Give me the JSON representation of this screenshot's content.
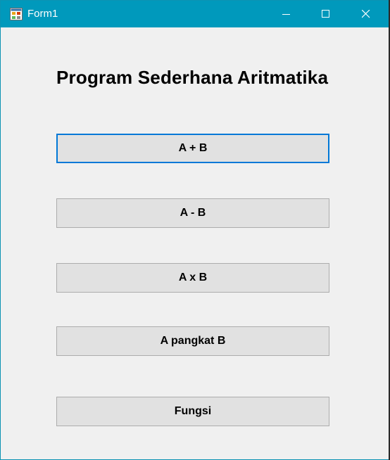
{
  "window": {
    "title": "Form1",
    "icon": "winforms-app-icon",
    "controls": {
      "minimize": "minimize-icon",
      "maximize": "maximize-icon",
      "close": "close-icon"
    },
    "colors": {
      "titlebar": "#0099bc",
      "client_background": "#f0f0f0",
      "button_background": "#e1e1e1",
      "button_border": "#adadad",
      "focus_border": "#0078d7"
    }
  },
  "form": {
    "heading": "Program Sederhana Aritmatika",
    "buttons": [
      {
        "label": "A + B",
        "focused": true
      },
      {
        "label": "A - B",
        "focused": false
      },
      {
        "label": "A x B",
        "focused": false
      },
      {
        "label": "A pangkat B",
        "focused": false
      },
      {
        "label": "Fungsi",
        "focused": false
      }
    ]
  }
}
